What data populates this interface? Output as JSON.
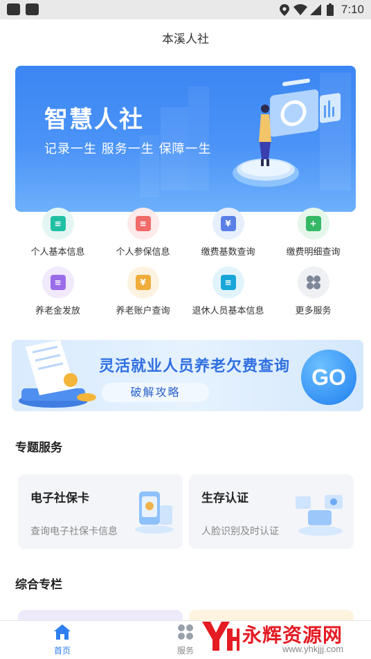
{
  "status_bar": {
    "time": "7:10"
  },
  "header": {
    "title": "本溪人社"
  },
  "banner": {
    "title": "智慧人社",
    "subtitle": "记录一生  服务一生  保障一生"
  },
  "grid": [
    {
      "label": "个人基本信息",
      "icon": "id-card-icon",
      "bg": "#e4f6f3",
      "tile": "#20bfa4"
    },
    {
      "label": "个人参保信息",
      "icon": "document-icon",
      "bg": "#fdeaea",
      "tile": "#f06a6a"
    },
    {
      "label": "缴费基数查询",
      "icon": "yuan-doc-icon",
      "bg": "#e7eefc",
      "tile": "#5a7fe6"
    },
    {
      "label": "缴费明细查询",
      "icon": "plus-doc-icon",
      "bg": "#e5f6ea",
      "tile": "#35b866"
    },
    {
      "label": "养老金发放",
      "icon": "pension-icon",
      "bg": "#f1e9fc",
      "tile": "#9b6ce8"
    },
    {
      "label": "养老账户查询",
      "icon": "account-icon",
      "bg": "#fdf2df",
      "tile": "#f0ad3c"
    },
    {
      "label": "退休人员基本信息",
      "icon": "retiree-icon",
      "bg": "#e1f4fb",
      "tile": "#18a6d8"
    },
    {
      "label": "更多服务",
      "icon": "more-icon",
      "bg": "#eef0f4",
      "tile": "#7e8799"
    }
  ],
  "promo": {
    "title": "灵活就业人员养老欠费查询",
    "pill": "破解攻略",
    "go": "GO"
  },
  "topics": {
    "title": "专题服务",
    "cards": [
      {
        "title": "电子社保卡",
        "subtitle": "查询电子社保卡信息"
      },
      {
        "title": "生存认证",
        "subtitle": "人脸识别及时认证"
      }
    ]
  },
  "column": {
    "title": "综合专栏"
  },
  "tabbar": {
    "tabs": [
      {
        "label": "首页",
        "active": true
      },
      {
        "label": "服务",
        "active": false
      }
    ]
  },
  "watermark": {
    "text": "永辉资源网",
    "url": "www.yhkjjj.com"
  },
  "colors": {
    "primary": "#2f7ff0",
    "tab_active": "#2f7ff0"
  }
}
